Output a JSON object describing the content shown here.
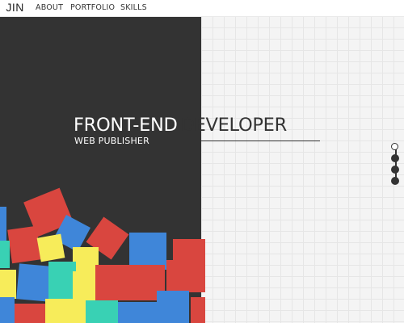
{
  "header": {
    "logo_text": "JIN",
    "nav": [
      {
        "label": "ABOUT"
      },
      {
        "label": "PORTFOLIO"
      },
      {
        "label": "SKILLS"
      }
    ]
  },
  "hero": {
    "title_left": "FRONT-END",
    "title_right": "DEVELOPER",
    "subtitle": "WEB PUBLISHER"
  },
  "pager": {
    "count": 4,
    "active_index": 0
  },
  "colors": {
    "dark_panel": "#333333",
    "red": "#d9463f",
    "blue": "#3f86d9",
    "yellow": "#f7ec5a",
    "teal": "#39d1b4"
  }
}
